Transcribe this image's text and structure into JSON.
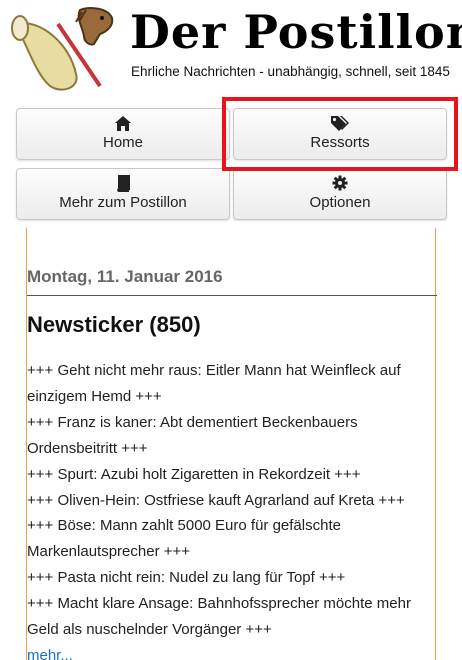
{
  "site": {
    "title": "Der Postillon",
    "tagline": "Ehrliche Nachrichten - unabhängig, schnell, seit 1845"
  },
  "nav": {
    "home": {
      "label": "Home",
      "icon": "home-icon"
    },
    "ressorts": {
      "label": "Ressorts",
      "icon": "tags-icon"
    },
    "mehr": {
      "label": "Mehr zum Postillon",
      "icon": "book-icon"
    },
    "optionen": {
      "label": "Optionen",
      "icon": "gear-icon"
    }
  },
  "post": {
    "date": "Montag, 11. Januar 2016",
    "title": "Newsticker (850)",
    "items": [
      "+++ Geht nicht mehr raus: Eitler Mann hat Weinfleck auf einzigem Hemd +++",
      "+++ Franz is kaner: Abt dementiert Beckenbauers Ordensbeitritt +++",
      "+++ Spurt: Azubi holt Zigaretten in Rekordzeit +++",
      "+++ Oliven-Hein: Ostfriese kauft Agrarland auf Kreta +++",
      "+++ Böse: Mann zahlt 5000 Euro für gefälschte Markenlautsprecher +++",
      "+++ Pasta nicht rein: Nudel zu lang für Topf +++",
      "+++ Macht klare Ansage: Bahnhofssprecher möchte mehr Geld als nuschelnder Vorgänger +++"
    ],
    "more": "mehr..."
  },
  "colors": {
    "accent_border": "#e8a33d",
    "highlight": "#e8141b",
    "link": "#1a6fd1"
  }
}
